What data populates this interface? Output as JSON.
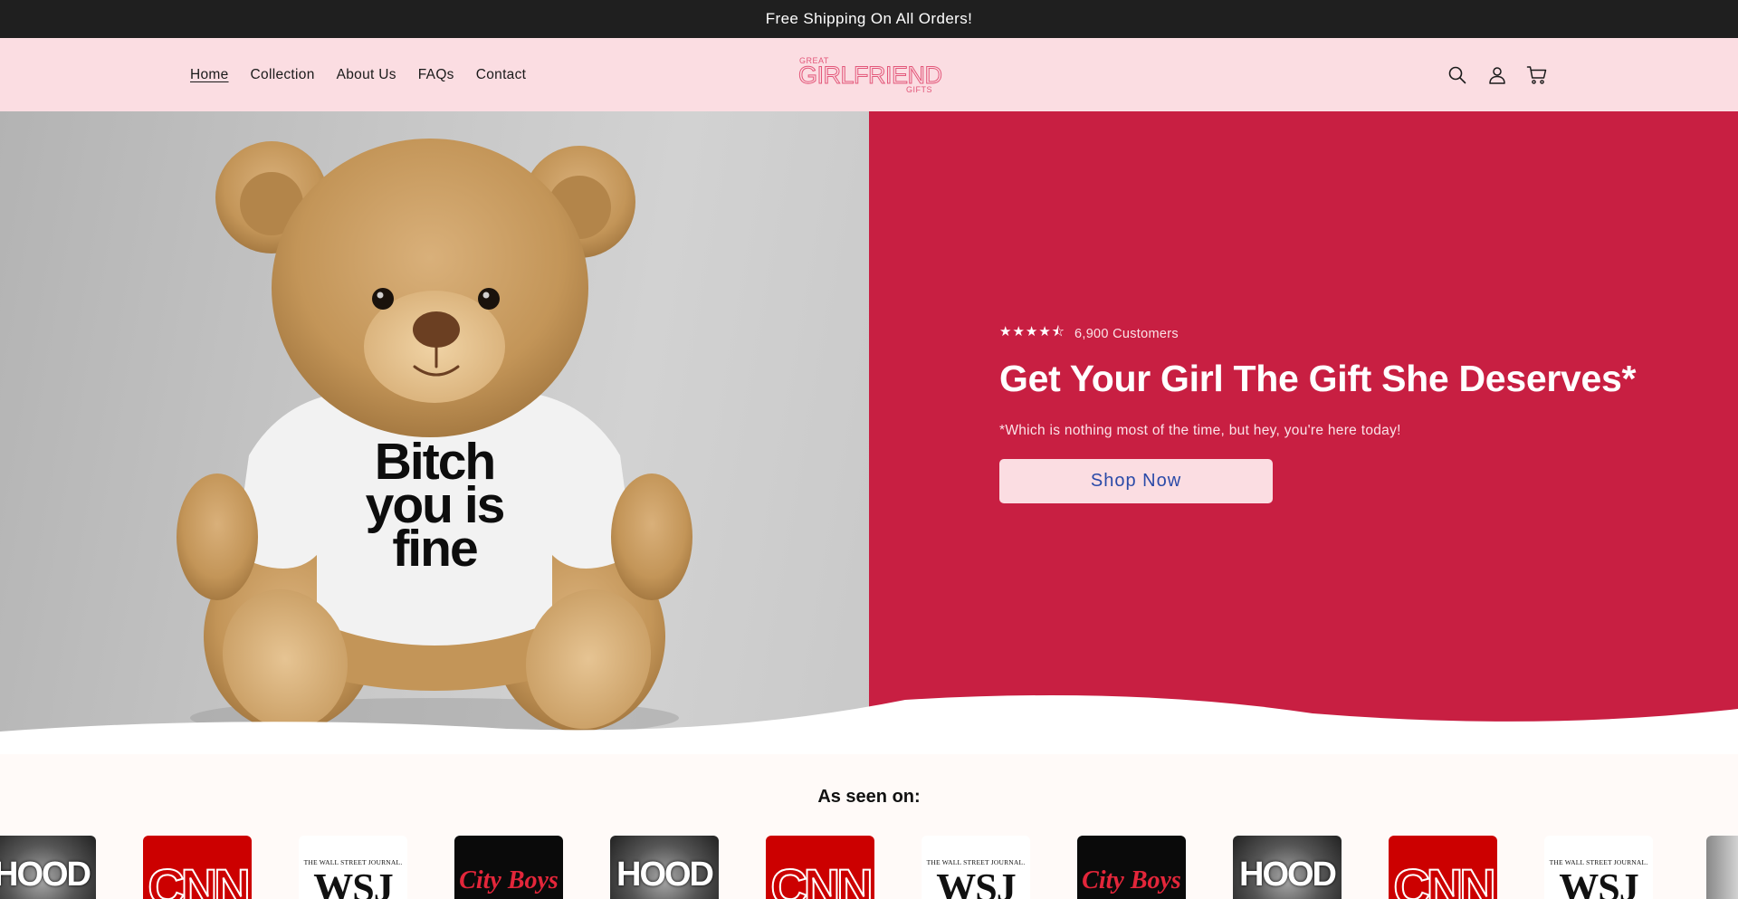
{
  "announcement": "Free Shipping On All Orders!",
  "nav": {
    "items": [
      "Home",
      "Collection",
      "About Us",
      "FAQs",
      "Contact"
    ],
    "active": "Home"
  },
  "logo": {
    "top": "GREAT",
    "main": "GIRLFRIEND",
    "bottom": "GIFTS"
  },
  "header_icons": [
    "search-icon",
    "account-icon",
    "cart-icon"
  ],
  "hero": {
    "stars": "★★★★⯪",
    "rating_text": "6,900 Customers",
    "headline": "Get Your Girl The Gift She Deserves*",
    "subtext": "*Which is nothing most of the time, but hey, you're here today!",
    "cta": "Shop Now",
    "image_shirt_text": [
      "Bitch",
      "you is",
      "fine"
    ]
  },
  "as_seen_on": {
    "title": "As seen on:",
    "logos": [
      "HOOD",
      "CNN",
      "WSJ",
      "City Boys",
      "HOOD",
      "CNN",
      "WSJ",
      "City Boys",
      "HOOD",
      "CNN",
      "WSJ"
    ]
  },
  "colors": {
    "announcement_bg": "#1f1f1f",
    "header_bg": "#fbdde2",
    "hero_right_bg": "#c81f42",
    "cta_text": "#2a4aa8",
    "logo": "#e3577a"
  }
}
